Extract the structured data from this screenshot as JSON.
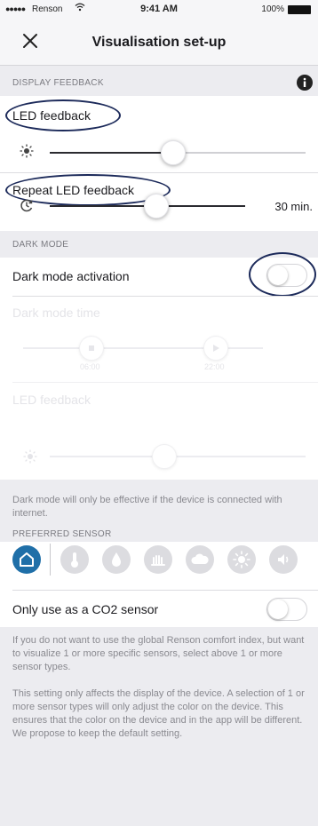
{
  "status_bar": {
    "signal": "●●●●●",
    "carrier": "Renson",
    "time": "9:41 AM",
    "battery": "100%"
  },
  "nav": {
    "title": "Visualisation set-up"
  },
  "display_feedback": {
    "header": "DISPLAY FEEDBACK",
    "led_feedback_label": "LED feedback",
    "led_feedback_level": 0.48,
    "repeat_label": "Repeat LED feedback",
    "repeat_level": 0.55,
    "repeat_value": "30 min."
  },
  "dark_mode": {
    "header": "DARK MODE",
    "activation_label": "Dark mode activation",
    "activation_on": false,
    "time_label": "Dark mode time",
    "start_time": "06:00",
    "end_time": "22:00",
    "led_label": "LED feedback",
    "note": "Dark mode will only be effective if the device is connected with internet."
  },
  "preferred_sensor": {
    "header": "PREFERRED SENSOR",
    "sensors": [
      "home-icon",
      "temperature-icon",
      "humidity-icon",
      "voc-icon",
      "co2-icon",
      "light-icon",
      "sound-icon"
    ],
    "selected": "home-icon",
    "co2_only_label": "Only use as a CO2 sensor",
    "co2_only_on": false,
    "note1": "If you do not want to use the global Renson comfort index, but want to visualize 1 or more specific sensors, select above 1 or more sensor types.",
    "note2": "This setting only affects the display of the device. A selection of 1 or more sensor types will only adjust the color on the device. This ensures that the color on the device and in the app will be different. We propose to keep the default setting."
  },
  "colors": {
    "accent": "#1f6fa8",
    "annotation": "#1c2a5a",
    "background": "#ececf0"
  }
}
